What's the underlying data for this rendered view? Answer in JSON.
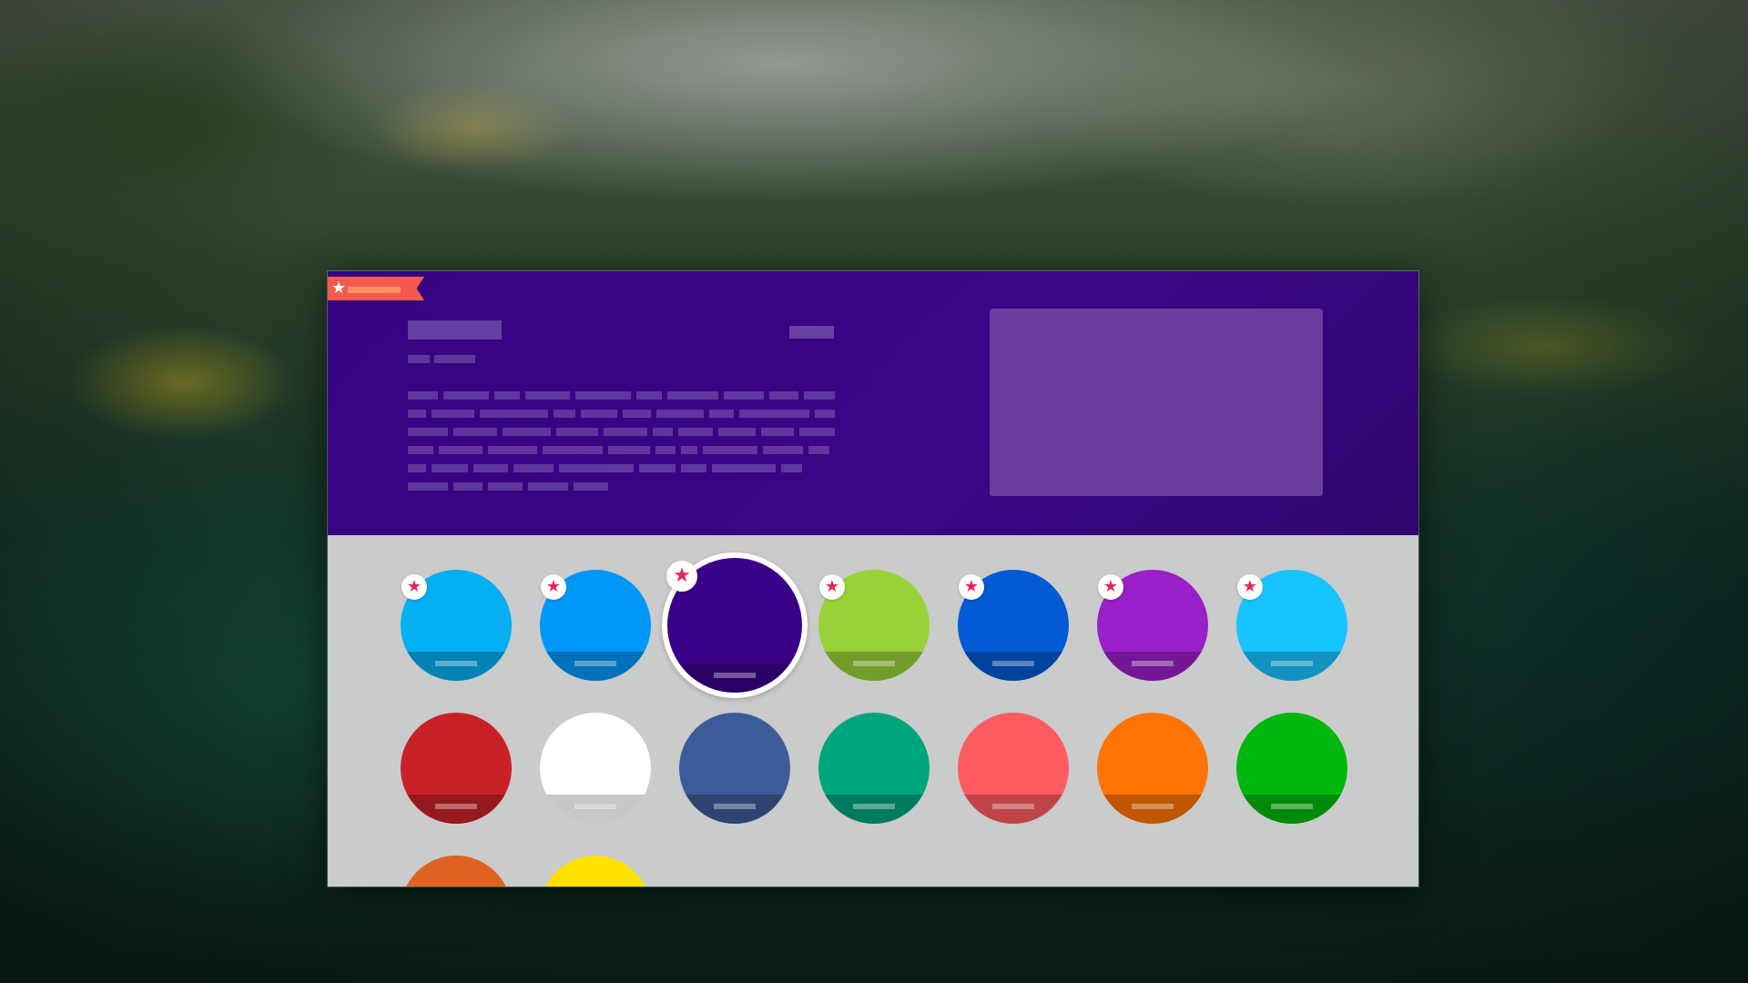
{
  "header": {
    "ribbon_icon": "star-icon",
    "accent_color": "#360382",
    "ribbon_color": "#f55a4e"
  },
  "badge_icon": "star-icon",
  "badge_color": "#e8245a",
  "swatches": [
    {
      "color": "#04aff2",
      "favorited": true,
      "selected": false
    },
    {
      "color": "#0097f8",
      "favorited": true,
      "selected": false
    },
    {
      "color": "#3a0088",
      "favorited": true,
      "selected": true
    },
    {
      "color": "#98d238",
      "favorited": true,
      "selected": false
    },
    {
      "color": "#005ad4",
      "favorited": true,
      "selected": false
    },
    {
      "color": "#9b1fc8",
      "favorited": true,
      "selected": false
    },
    {
      "color": "#18c4ff",
      "favorited": true,
      "selected": false
    },
    {
      "color": "#c82228",
      "favorited": false,
      "selected": false
    },
    {
      "color": "#ffffff",
      "favorited": false,
      "selected": false
    },
    {
      "color": "#3c5b99",
      "favorited": false,
      "selected": false
    },
    {
      "color": "#00a57c",
      "favorited": false,
      "selected": false
    },
    {
      "color": "#fe5b61",
      "favorited": false,
      "selected": false
    },
    {
      "color": "#ff7404",
      "favorited": false,
      "selected": false
    },
    {
      "color": "#00b80d",
      "favorited": false,
      "selected": false
    },
    {
      "color": "#e06222",
      "favorited": false,
      "selected": false
    },
    {
      "color": "#ffe100",
      "favorited": false,
      "selected": false
    }
  ]
}
